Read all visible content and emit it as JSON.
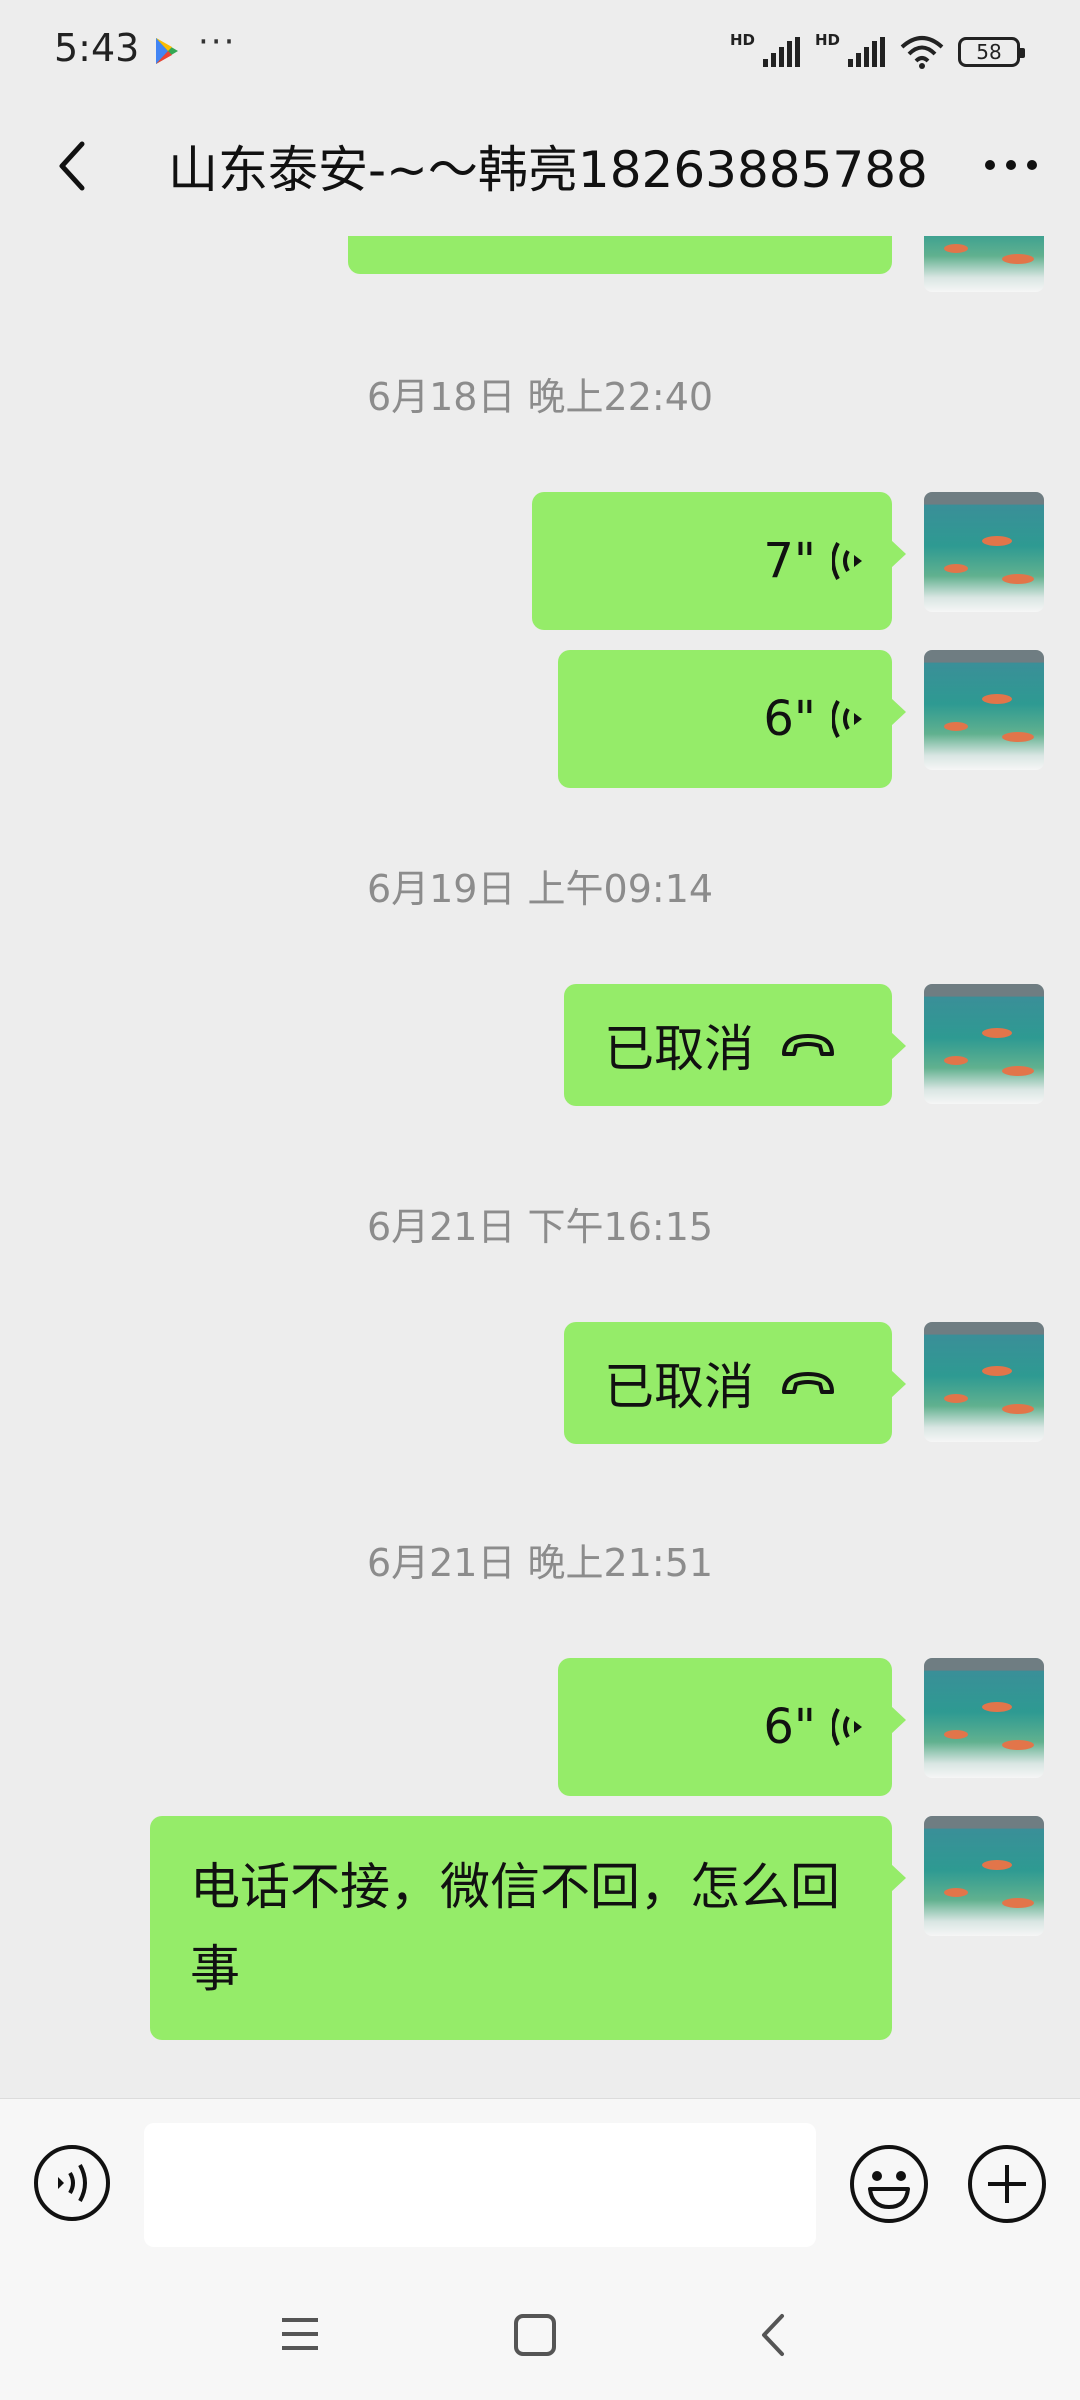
{
  "status_bar": {
    "time": "5:43",
    "more_glyph": "···",
    "hd1": "HD",
    "hd2": "HD",
    "battery": "58"
  },
  "header": {
    "title": "山东泰安-~～韩亮18263885788",
    "back_icon": "back-arrow-icon",
    "more_icon": "more-dots-icon"
  },
  "chat": {
    "timestamps": [
      "6月18日 晚上22:40",
      "6月19日 上午09:14",
      "6月21日 下午16:15",
      "6月21日 晚上21:51"
    ],
    "messages": [
      {
        "type": "text",
        "text": "",
        "partial": true
      },
      {
        "type": "voice",
        "duration": "7\""
      },
      {
        "type": "voice",
        "duration": "6\""
      },
      {
        "type": "call",
        "text": "已取消"
      },
      {
        "type": "call",
        "text": "已取消"
      },
      {
        "type": "voice",
        "duration": "6\""
      },
      {
        "type": "text",
        "text": "电话不接，微信不回，怎么回事"
      }
    ]
  },
  "input_bar": {
    "voice_icon": "voice-input-icon",
    "placeholder": "",
    "emoji_icon": "emoji-icon",
    "plus_icon": "plus-icon"
  },
  "colors": {
    "background": "#ededed",
    "bubble": "#95ec69",
    "timestamp": "#8c8c8c",
    "bar": "#f7f7f7"
  }
}
